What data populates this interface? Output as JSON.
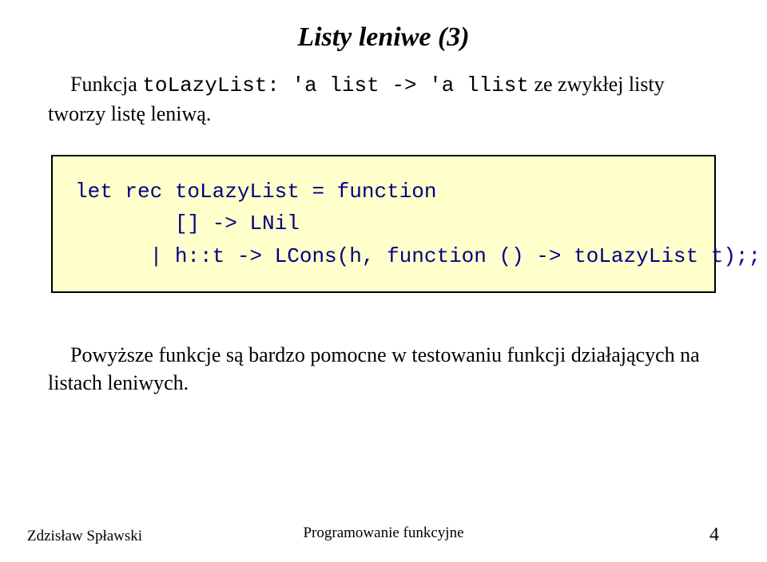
{
  "title": "Listy leniwe (3)",
  "intro": {
    "prefix": "Funkcja ",
    "func_sig": "toLazyList: 'a list -> 'a llist",
    "suffix": " ze zwykłej listy tworzy listę leniwą."
  },
  "code": "let rec toLazyList = function\n        [] -> LNil\n      | h::t -> LCons(h, function () -> toLazyList t);;",
  "conclusion": "Powyższe funkcje są bardzo pomocne w testowaniu funkcji działających na listach leniwych.",
  "footer": {
    "author": "Zdzisław Spławski",
    "course": "Programowanie funkcyjne",
    "page": "4"
  }
}
